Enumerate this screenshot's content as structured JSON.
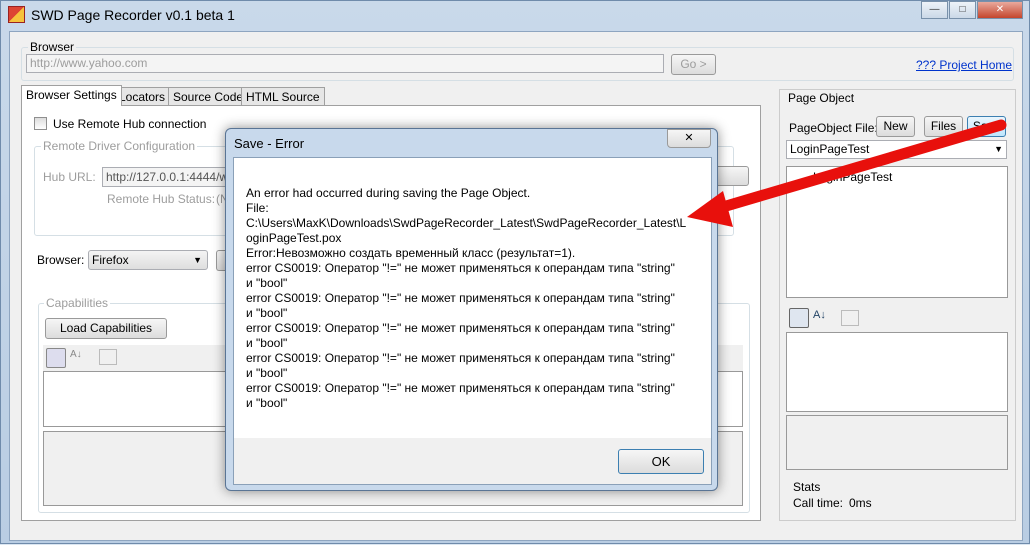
{
  "window": {
    "title": "SWD Page Recorder v0.1 beta 1",
    "minimize": "—",
    "maximize": "□",
    "close": "✕"
  },
  "browser_group": {
    "label": "Browser",
    "url": "http://www.yahoo.com",
    "go_label": "Go >",
    "project_home": "??? Project Home"
  },
  "tabs": [
    {
      "label": "Browser Settings"
    },
    {
      "label": "Locators"
    },
    {
      "label": "Source Code"
    },
    {
      "label": "HTML Source"
    }
  ],
  "settings": {
    "use_remote_hub": "Use Remote Hub connection",
    "remote_group": "Remote Driver Configuration",
    "hub_url_label": "Hub URL:",
    "hub_url": "http://127.0.0.1:4444/wd",
    "hub_status_label": "Remote Hub Status:",
    "hub_status": "(N",
    "browser_label": "Browser:",
    "browser_value": "Firefox",
    "capabilities_group": "Capabilities",
    "load_capabilities": "Load Capabilities"
  },
  "page_object": {
    "label": "Page Object",
    "file_label": "PageObject File:",
    "new": "New",
    "files": "Files",
    "save": "Save",
    "selected_file": "LoginPageTest",
    "tree_item": "LoginPageTest",
    "stats_label": "Stats",
    "call_time_label": "Call time:",
    "call_time": "0ms"
  },
  "dialog": {
    "title": "Save - Error",
    "ok": "OK",
    "lines": [
      "An error had occurred during saving the Page Object.",
      "File:",
      "C:\\Users\\MaxK\\Downloads\\SwdPageRecorder_Latest\\SwdPageRecorder_Latest\\L",
      "oginPageTest.pox",
      "Error:Невозможно создать временный класс (результат=1).",
      "error CS0019: Оператор \"!=\" не может применяться к операндам типа \"string\"",
      "и \"bool\"",
      "error CS0019: Оператор \"!=\" не может применяться к операндам типа \"string\"",
      "и \"bool\"",
      "error CS0019: Оператор \"!=\" не может применяться к операндам типа \"string\"",
      "и \"bool\"",
      "error CS0019: Оператор \"!=\" не может применяться к операндам типа \"string\"",
      "и \"bool\"",
      "error CS0019: Оператор \"!=\" не может применяться к операндам типа \"string\"",
      "и \"bool\""
    ]
  },
  "annotation": {
    "arrow_color": "#e8100c"
  }
}
